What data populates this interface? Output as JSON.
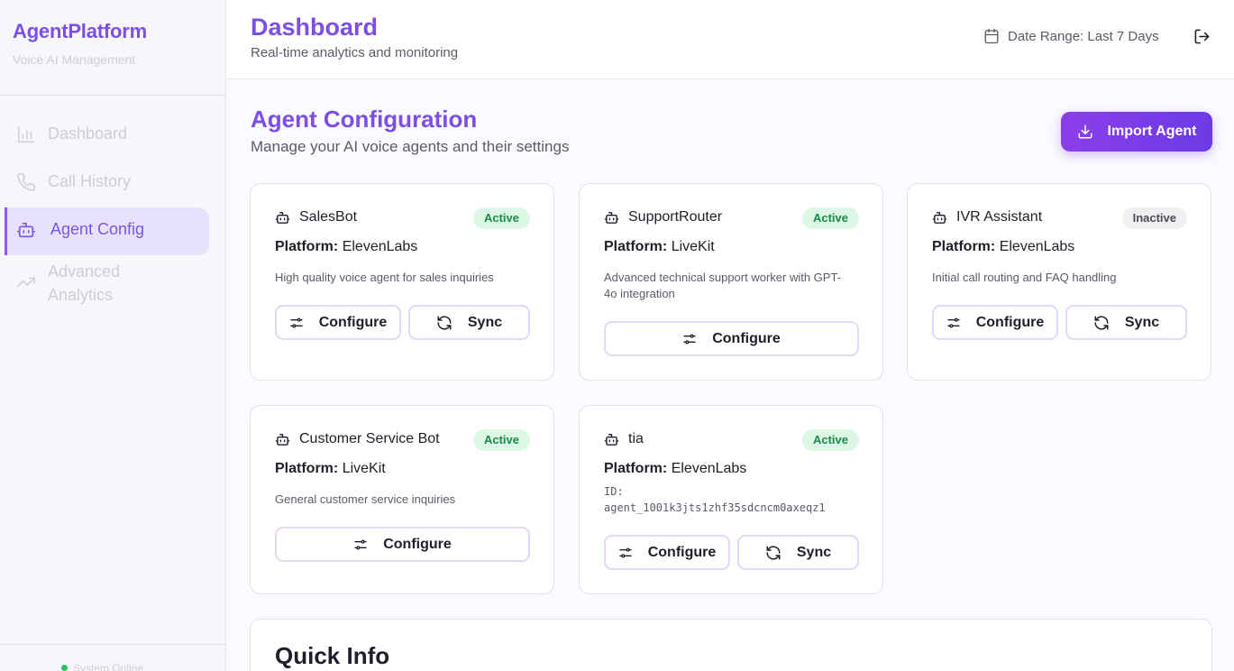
{
  "sidebar": {
    "brand_title": "AgentPlatform",
    "brand_subtitle": "Voice AI Management",
    "items": [
      {
        "label": "Dashboard",
        "icon": "bar-chart-icon",
        "active": false
      },
      {
        "label": "Call History",
        "icon": "phone-icon",
        "active": false
      },
      {
        "label": "Agent Config",
        "icon": "bot-icon",
        "active": true
      },
      {
        "label": "Advanced Analytics",
        "icon": "trending-up-icon",
        "active": false
      }
    ],
    "status_text": "System Online"
  },
  "header": {
    "title": "Dashboard",
    "subtitle": "Real-time analytics and monitoring",
    "date_range": "Date Range: Last 7 Days"
  },
  "section": {
    "title": "Agent Configuration",
    "subtitle": "Manage your AI voice agents and their settings",
    "import_label": "Import Agent"
  },
  "platform_label": "Platform:",
  "buttons": {
    "configure": "Configure",
    "sync": "Sync"
  },
  "agents": [
    {
      "name": "SalesBot",
      "status": "Active",
      "platform": "ElevenLabs",
      "description": "High quality voice agent for sales inquiries"
    },
    {
      "name": "SupportRouter",
      "status": "Active",
      "platform": "LiveKit",
      "description": "Advanced technical support worker with GPT-4o integration"
    },
    {
      "name": "IVR Assistant",
      "status": "Inactive",
      "platform": "ElevenLabs",
      "description": "Initial call routing and FAQ handling"
    },
    {
      "name": "Customer Service Bot",
      "status": "Active",
      "platform": "LiveKit",
      "description": "General customer service inquiries"
    },
    {
      "name": "tia",
      "status": "Active",
      "platform": "ElevenLabs",
      "id_label": "ID:",
      "id_value": "agent_1001k3jts1zhf35sdcncm0axeqz1"
    }
  ],
  "quick_info": {
    "title": "Quick Info"
  },
  "colors": {
    "accent": "#7b4fe3",
    "active_badge": "#dcf7e5",
    "online": "#23c55e"
  }
}
